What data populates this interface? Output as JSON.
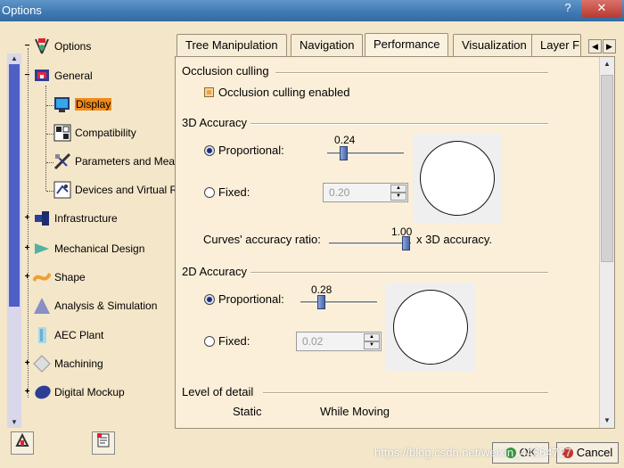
{
  "window": {
    "title": "Options",
    "help_label": "?",
    "close_label": "✕"
  },
  "tree": {
    "root": {
      "label": "Options",
      "icon": "options-icon"
    },
    "items": [
      {
        "label": "General",
        "icon": "general-icon"
      },
      {
        "label": "Display",
        "icon": "display-icon",
        "selected": true
      },
      {
        "label": "Compatibility",
        "icon": "compatibility-icon"
      },
      {
        "label": "Parameters and Meas",
        "icon": "parameters-icon"
      },
      {
        "label": "Devices and Virtual R",
        "icon": "devices-icon"
      },
      {
        "label": "Infrastructure",
        "icon": "infrastructure-icon"
      },
      {
        "label": "Mechanical Design",
        "icon": "mechanical-design-icon"
      },
      {
        "label": "Shape",
        "icon": "shape-icon"
      },
      {
        "label": "Analysis & Simulation",
        "icon": "analysis-icon"
      },
      {
        "label": "AEC Plant",
        "icon": "aec-plant-icon"
      },
      {
        "label": "Machining",
        "icon": "machining-icon"
      },
      {
        "label": "Digital Mockup",
        "icon": "digital-mockup-icon"
      }
    ]
  },
  "tabs": [
    {
      "label": "Tree Manipulation"
    },
    {
      "label": "Navigation"
    },
    {
      "label": "Performance",
      "active": true
    },
    {
      "label": "Visualization"
    },
    {
      "label": "Layer Fi"
    }
  ],
  "occlusion": {
    "group_title": "Occlusion culling",
    "checkbox_label": "Occlusion culling enabled",
    "checked": true
  },
  "accuracy3d": {
    "group_title": "3D Accuracy",
    "proportional_label": "Proportional:",
    "proportional_selected": true,
    "proportional_value": "0.24",
    "fixed_label": "Fixed:",
    "fixed_value": "0.20",
    "curves_label": "Curves' accuracy ratio:",
    "curves_value": "1.00",
    "curves_suffix": "x 3D accuracy."
  },
  "accuracy2d": {
    "group_title": "2D Accuracy",
    "proportional_label": "Proportional:",
    "proportional_selected": true,
    "proportional_value": "0.28",
    "fixed_label": "Fixed:",
    "fixed_value": "0.02"
  },
  "level_of_detail": {
    "group_title": "Level of detail",
    "static_label": "Static",
    "moving_label": "While Moving"
  },
  "footer": {
    "ok_label": "OK",
    "cancel_label": "Cancel",
    "watermark": "https://blog.csdn.net/weixin_44364727"
  },
  "colors": {
    "selection": "#f08a1c",
    "panel_bg": "#fbefd9",
    "title_bar": "#3f78b2"
  }
}
